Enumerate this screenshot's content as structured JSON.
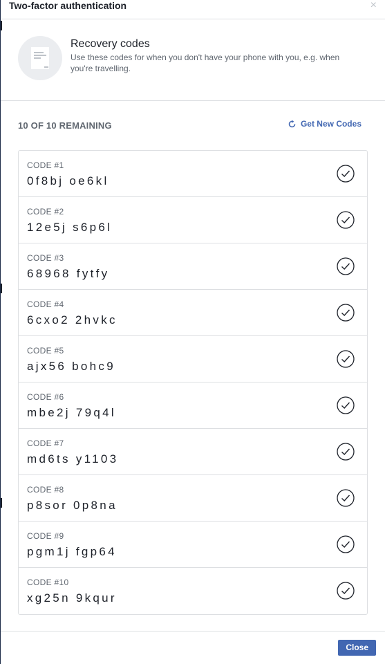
{
  "dialog": {
    "title": "Two-factor authentication",
    "close_glyph": "×"
  },
  "intro": {
    "icon": "note-icon",
    "heading": "Recovery codes",
    "description": "Use these codes for when you don't have your phone with you, e.g. when you're travelling."
  },
  "codes_header": {
    "remaining": "10 OF 10 REMAINING",
    "get_new_label": "Get New Codes",
    "get_new_icon": "refresh-icon"
  },
  "codes": [
    {
      "label": "CODE #1",
      "value": "0f8bj oe6kl"
    },
    {
      "label": "CODE #2",
      "value": "12e5j s6p6l"
    },
    {
      "label": "CODE #3",
      "value": "68968 fytfy"
    },
    {
      "label": "CODE #4",
      "value": "6cxo2 2hvkc"
    },
    {
      "label": "CODE #5",
      "value": "ajx56 bohc9"
    },
    {
      "label": "CODE #6",
      "value": "mbe2j 79q4l"
    },
    {
      "label": "CODE #7",
      "value": "md6ts y1103"
    },
    {
      "label": "CODE #8",
      "value": "p8sor 0p8na"
    },
    {
      "label": "CODE #9",
      "value": "pgm1j fgp64"
    },
    {
      "label": "CODE #10",
      "value": "xg25n 9kqur"
    }
  ],
  "footer": {
    "close_label": "Close"
  },
  "colors": {
    "accent": "#4267b2",
    "border": "#dddfe2",
    "muted_text": "#606770"
  }
}
